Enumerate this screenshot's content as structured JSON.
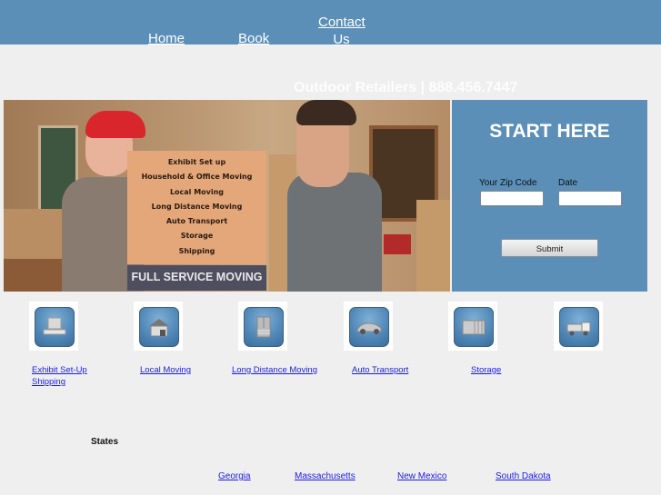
{
  "nav": {
    "home": "Home",
    "book": "Book",
    "contact_line1": "Contact",
    "contact_line2": "Us"
  },
  "header": {
    "tagline": "Outdoor Retailers | 888.456.7447"
  },
  "hero": {
    "menu_items": [
      "Exhibit Set up",
      "Household & Office Moving",
      "Local Moving",
      "Long Distance Moving",
      "Auto Transport",
      "Storage",
      "Shipping"
    ],
    "banner": "FULL SERVICE MOVING"
  },
  "form": {
    "title": "START HERE",
    "zip_label": "Your Zip Code",
    "zip_value": "",
    "date_label": "Date",
    "date_value": "",
    "submit": "Submit"
  },
  "services": [
    {
      "icon": "pallet-box-icon",
      "label": "Exhibit Set-Up",
      "label2": "Shipping"
    },
    {
      "icon": "house-icon",
      "label": "Local Moving"
    },
    {
      "icon": "cabinet-icon",
      "label": "Long Distance Moving"
    },
    {
      "icon": "car-icon",
      "label": "Auto Transport"
    },
    {
      "icon": "storage-container-icon",
      "label": "Storage"
    },
    {
      "icon": "truck-icon",
      "label": ""
    }
  ],
  "states": {
    "heading": "States",
    "items": [
      "Georgia",
      "Massachusetts",
      "New Mexico",
      "South Dakota"
    ]
  },
  "colors": {
    "brand_blue": "#5b8fb8",
    "menu_card": "#e4a77a",
    "banner": "#4f4e5f",
    "link": "#1a1aee"
  }
}
